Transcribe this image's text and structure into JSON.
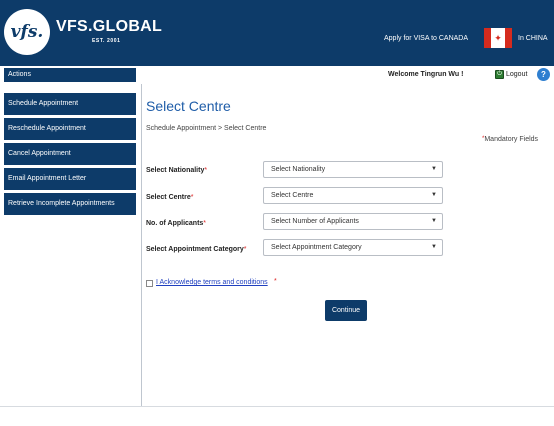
{
  "header": {
    "logo_text": "vfs.",
    "brand": "VFS.GLOBAL",
    "brand_sub": "EST. 2001",
    "apply_text": "Apply for VISA to CANADA",
    "flag_icon": "canada-flag-icon",
    "country": "In CHINA"
  },
  "topbar": {
    "actions_label": "Actions",
    "welcome": "Welcome Tingrun Wu !",
    "logout": "Logout",
    "help": "?"
  },
  "sidebar": {
    "items": [
      {
        "label": "Schedule Appointment"
      },
      {
        "label": "Reschedule Appointment"
      },
      {
        "label": "Cancel Appointment"
      },
      {
        "label": "Email Appointment Letter"
      },
      {
        "label": "Retrieve Incomplete Appointments"
      }
    ]
  },
  "main": {
    "title": "Select Centre",
    "breadcrumb": "Schedule Appointment  >  Select Centre",
    "mandatory_star": "*",
    "mandatory": "Mandatory Fields",
    "fields": [
      {
        "label": "Select Nationality",
        "req": "*",
        "value": "Select Nationality"
      },
      {
        "label": "Select Centre",
        "req": "*",
        "value": "Select Centre"
      },
      {
        "label": "No. of Applicants",
        "req": "*",
        "value": "Select Number of Applicants"
      },
      {
        "label": "Select Appointment Category",
        "req": "*",
        "value": "Select Appointment Category"
      }
    ],
    "acknowledge": "I Acknowledge terms and conditions ",
    "acknowledge_star": "*",
    "continue": "Continue"
  },
  "colors": {
    "brand_navy": "#0d3b69",
    "title_blue": "#1f5da8",
    "required_red": "#d22222",
    "link_blue": "#1f3fbf"
  }
}
